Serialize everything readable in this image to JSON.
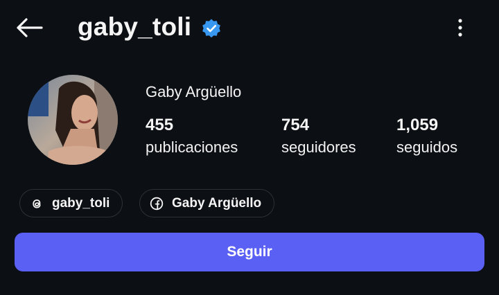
{
  "header": {
    "username": "gaby_toli",
    "back_icon": "arrow-left-icon",
    "verified_icon": "verified-badge-icon",
    "menu_icon": "more-vertical-icon"
  },
  "profile": {
    "display_name": "Gaby Argüello",
    "stats": [
      {
        "value": "455",
        "label": "publicaciones"
      },
      {
        "value": "754",
        "label": "seguidores"
      },
      {
        "value": "1,059",
        "label": "seguidos"
      }
    ]
  },
  "links": [
    {
      "icon": "threads-icon",
      "label": "gaby_toli"
    },
    {
      "icon": "facebook-icon",
      "label": "Gaby Argüello"
    }
  ],
  "actions": {
    "follow_label": "Seguir"
  },
  "colors": {
    "background": "#0c0f14",
    "accent": "#5b60f5",
    "verified": "#3897f0",
    "chip_border": "#2d3138"
  }
}
